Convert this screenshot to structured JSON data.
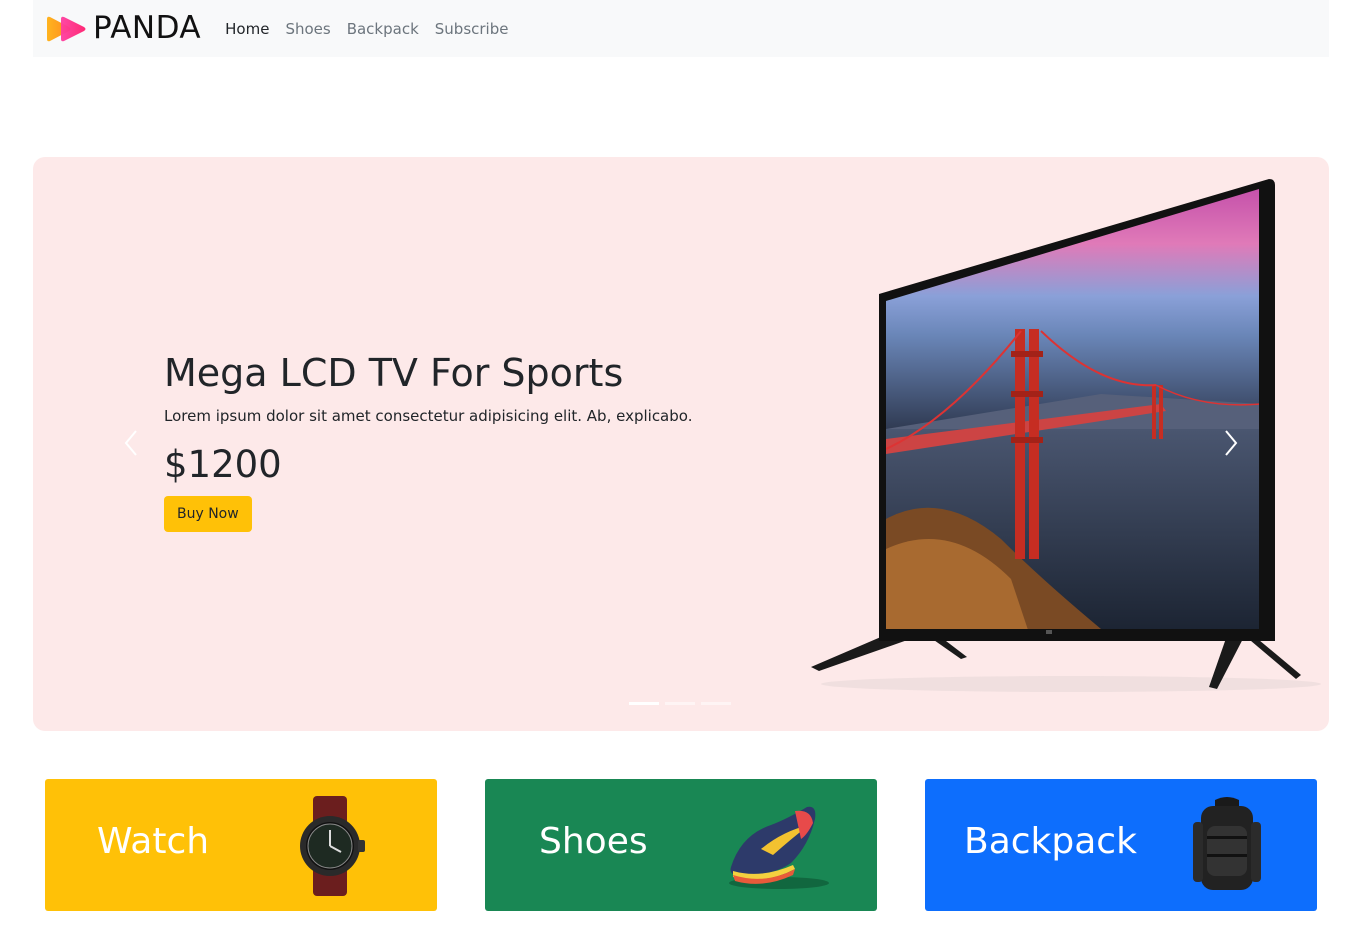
{
  "navbar": {
    "brand": "PANDA",
    "links": [
      {
        "label": "Home",
        "active": true
      },
      {
        "label": "Shoes",
        "active": false
      },
      {
        "label": "Backpack",
        "active": false
      },
      {
        "label": "Subscribe",
        "active": false
      }
    ]
  },
  "hero": {
    "title": "Mega LCD TV For Sports",
    "description": "Lorem ipsum dolor sit amet consectetur adipisicing elit. Ab, explicabo.",
    "price": "$1200",
    "button_label": "Buy Now",
    "background_color": "#fde9e9",
    "slide_count": 3,
    "active_slide": 1
  },
  "categories": [
    {
      "label": "Watch",
      "color": "#ffc107",
      "icon": "watch-icon"
    },
    {
      "label": "Shoes",
      "color": "#198754",
      "icon": "sneaker-icon"
    },
    {
      "label": "Backpack",
      "color": "#0d6efd",
      "icon": "backpack-icon"
    }
  ],
  "colors": {
    "accent": "#ffc107",
    "nav_bg": "#f8f9fa"
  }
}
